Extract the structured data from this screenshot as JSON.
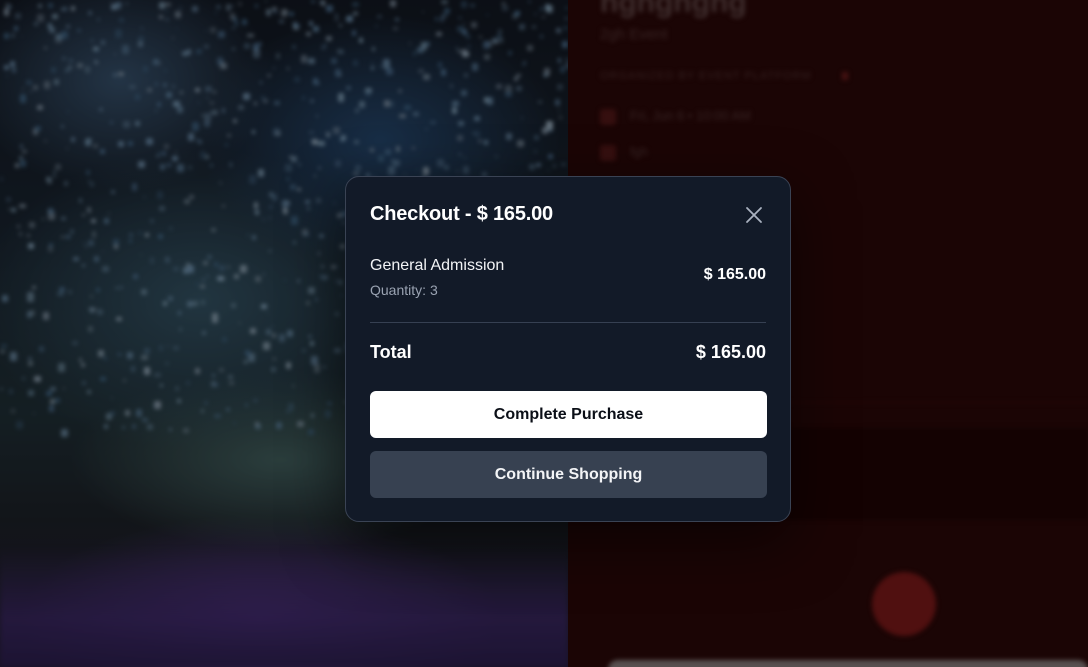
{
  "background": {
    "event_title": "hghghghg",
    "event_subtitle": "2gh Event",
    "organizer": "ORGANIZED BY EVENT PLATFORM",
    "date_text": "Fri, Jun 6 • 10:00 AM",
    "location_text": "fgh",
    "accent_color": "#8a1c1c"
  },
  "checkout": {
    "title_prefix": "Checkout - ",
    "title_amount": "$ 165.00",
    "close_icon": "close-icon",
    "item": {
      "name": "General Admission",
      "quantity_label": "Quantity:",
      "quantity": "3",
      "price": "$ 165.00"
    },
    "total_label": "Total",
    "total_value": "$ 165.00",
    "complete_button": "Complete Purchase",
    "continue_button": "Continue Shopping"
  },
  "colors": {
    "modal_bg": "#121a28",
    "primary_button": "#ffffff",
    "secondary_button": "#374151"
  }
}
